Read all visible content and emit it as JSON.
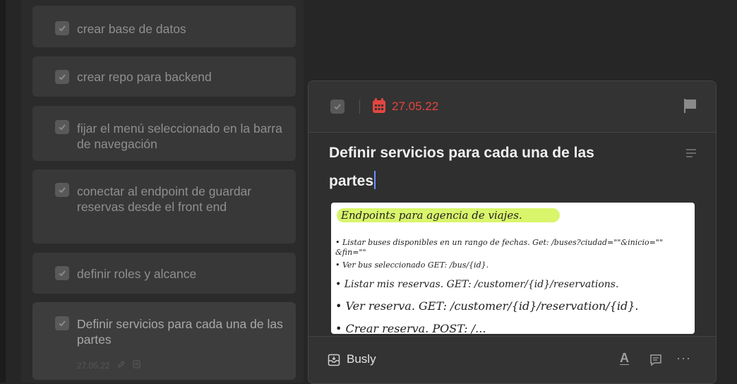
{
  "tasks": [
    {
      "label": "crear base de datos"
    },
    {
      "label": "crear repo para backend"
    },
    {
      "label": "fijar el menú seleccionado en la barra de navegación"
    },
    {
      "label": "conectar al endpoint de guardar reservas desde el front end"
    },
    {
      "label": "definir roles y alcance"
    },
    {
      "label": "Definir servicios para cada una de las partes",
      "meta_date": "27.05.22"
    }
  ],
  "detail": {
    "date": "27.05.22",
    "title": "Definir servicios para cada una de las partes",
    "note_lines": [
      "Endpoints para agencia de viajes.",
      "• Listar buses disponibles en un rango de fechas.  Get: /buses?ciudad=\"\"&inicio=\"\"",
      "  &fin=\"\"",
      "• Ver bus seleccionado  GET: /bus/{id}.",
      "• Listar mis reservas.  GET: /customer/{id}/reservations.",
      "• Ver reserva.  GET: /customer/{id}/reservation/{id}.",
      "• Crear reserva.  POST: /..."
    ],
    "project": "Busly",
    "format_label": "A",
    "more_label": "···"
  },
  "colors": {
    "accent_date": "#e5453f",
    "caret": "#6f8fff",
    "highlight": "#d9f56b"
  }
}
